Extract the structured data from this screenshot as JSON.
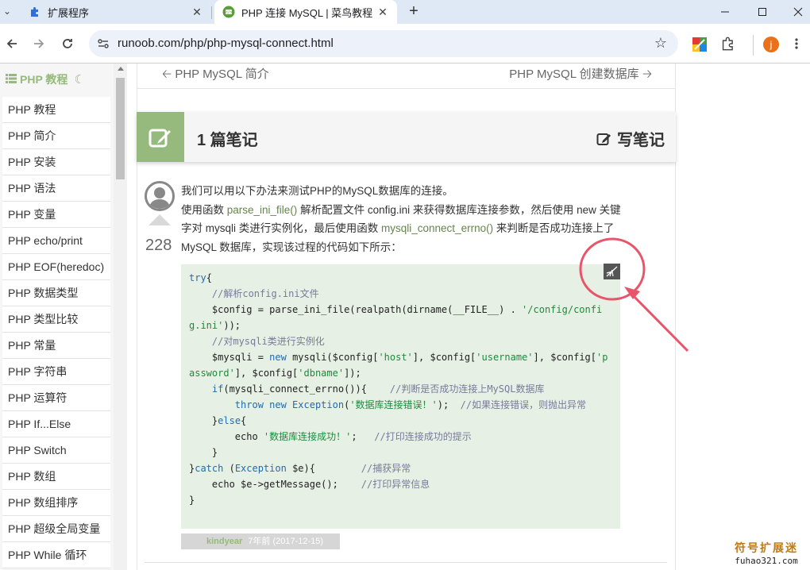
{
  "browser": {
    "tabs": [
      {
        "title": "扩展程序",
        "active": false
      },
      {
        "title": "PHP 连接 MySQL | 菜鸟教程",
        "active": true
      }
    ],
    "url": "runoob.com/php/php-mysql-connect.html",
    "profile_initial": "j"
  },
  "sidebar": {
    "title": "PHP 教程",
    "items": [
      "PHP 教程",
      "PHP 简介",
      "PHP 安装",
      "PHP 语法",
      "PHP 变量",
      "PHP echo/print",
      "PHP EOF(heredoc)",
      "PHP 数据类型",
      "PHP 类型比较",
      "PHP 常量",
      "PHP 字符串",
      "PHP 运算符",
      "PHP If...Else",
      "PHP Switch",
      "PHP 数组",
      "PHP 数组排序",
      "PHP 超级全局变量",
      "PHP While 循环"
    ]
  },
  "nav": {
    "prev": "PHP MySQL 简介",
    "next": "PHP MySQL 创建数据库"
  },
  "notes": {
    "count_label": "1 篇笔记",
    "write_label": "写笔记"
  },
  "note": {
    "votes": "228",
    "line1": "我们可以用以下办法来测试PHP的MySQL数据库的连接。",
    "line2_a": "使用函数 ",
    "fn1": "parse_ini_file()",
    "line2_b": " 解析配置文件 config.ini 来获得数据库连接参数，然后使用 new 关键字对 mysqli 类进行实例化，最后使用函数 ",
    "fn2": "mysqli_connect_errno()",
    "line2_c": " 来判断是否成功连接上了 MySQL 数据库，实现该过程的代码如下所示：",
    "author": "kindyear",
    "time": "7年前 (2017-12-15)"
  },
  "watermark": {
    "main": "符号扩展迷",
    "sub": "fuhao321.com"
  },
  "colors": {
    "accent_green": "#96b97d",
    "code_bg": "#e6f0e4",
    "annotation_red": "#e8556a"
  }
}
